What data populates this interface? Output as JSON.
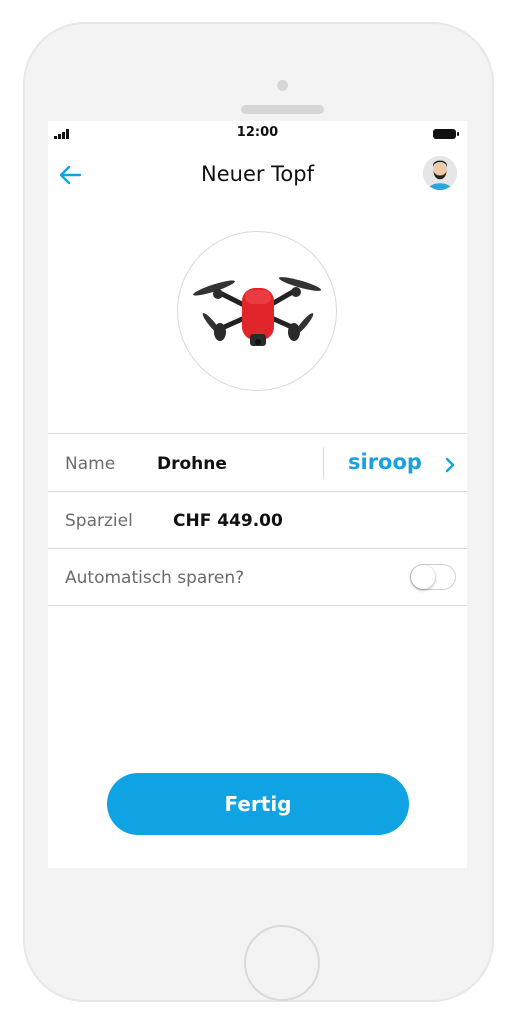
{
  "status_bar": {
    "time": "12:00"
  },
  "header": {
    "title": "Neuer Topf"
  },
  "product": {
    "image": "drone-photo"
  },
  "rows": [
    {
      "label": "Name",
      "value": "Drohne",
      "brand": "siroop"
    },
    {
      "label": "Sparziel",
      "value": "CHF 449.00"
    },
    {
      "label": "Automatisch sparen?",
      "toggle_on": false
    }
  ],
  "footer": {
    "button_label": "Fertig"
  },
  "icons": {
    "back": "arrow-left-icon",
    "avatar": "user-avatar",
    "chevron": "chevron-right-icon"
  },
  "colors": {
    "accent": "#10a3e3",
    "brand": "#19a0e0",
    "text_primary": "#111111",
    "text_secondary": "#6b6b6b",
    "divider": "#dcdcdc"
  }
}
